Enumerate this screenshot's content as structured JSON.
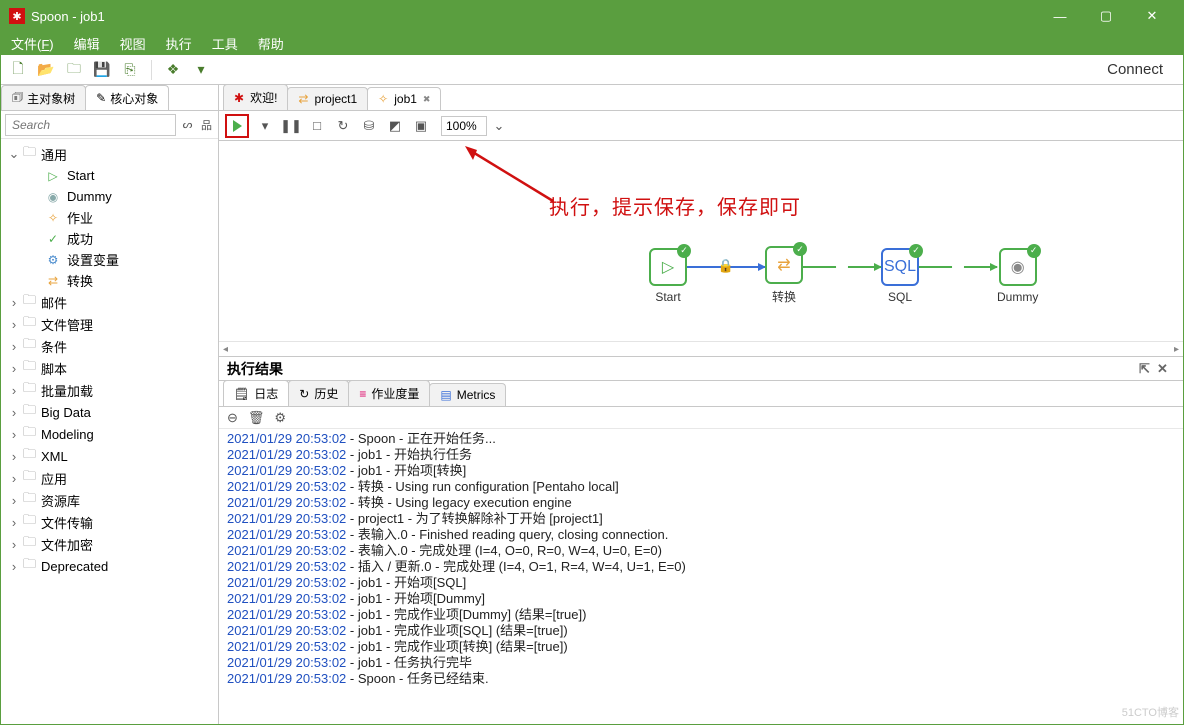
{
  "window": {
    "title": "Spoon - job1"
  },
  "menubar": [
    "文件(F)",
    "编辑",
    "视图",
    "执行",
    "工具",
    "帮助"
  ],
  "toolbar_connect": "Connect",
  "side_tabs": {
    "active": "主对象树",
    "inactive": "核心对象"
  },
  "search": {
    "placeholder": "Search"
  },
  "tree": {
    "general": {
      "label": "通用",
      "items": [
        "Start",
        "Dummy",
        "作业",
        "成功",
        "设置变量",
        "转换"
      ]
    },
    "folders": [
      "邮件",
      "文件管理",
      "条件",
      "脚本",
      "批量加载",
      "Big Data",
      "Modeling",
      "XML",
      "应用",
      "资源库",
      "文件传输",
      "文件加密",
      "Deprecated"
    ]
  },
  "doc_tabs": [
    {
      "label": "欢迎!",
      "icon": "app"
    },
    {
      "label": "project1",
      "icon": "trans"
    },
    {
      "label": "job1",
      "icon": "job",
      "closable": true,
      "active": true
    }
  ],
  "zoom": "100%",
  "annotation": "执行，提示保存，保存即可",
  "nodes": {
    "start": "Start",
    "trans": "转换",
    "sql": "SQL",
    "dummy": "Dummy"
  },
  "results_title": "执行结果",
  "results_tabs": [
    "日志",
    "历史",
    "作业度量",
    "Metrics"
  ],
  "log": [
    {
      "ts": "2021/01/29 20:53:02",
      "msg": "Spoon - 正在开始任务..."
    },
    {
      "ts": "2021/01/29 20:53:02",
      "msg": "job1 - 开始执行任务"
    },
    {
      "ts": "2021/01/29 20:53:02",
      "msg": "job1 - 开始项[转换]"
    },
    {
      "ts": "2021/01/29 20:53:02",
      "msg": "转换 - Using run configuration [Pentaho local]"
    },
    {
      "ts": "2021/01/29 20:53:02",
      "msg": "转换 - Using legacy execution engine"
    },
    {
      "ts": "2021/01/29 20:53:02",
      "msg": "project1 - 为了转换解除补丁开始  [project1]"
    },
    {
      "ts": "2021/01/29 20:53:02",
      "msg": "表输入.0 - Finished reading query, closing connection."
    },
    {
      "ts": "2021/01/29 20:53:02",
      "msg": "表输入.0 - 完成处理 (I=4, O=0, R=0, W=4, U=0, E=0)"
    },
    {
      "ts": "2021/01/29 20:53:02",
      "msg": "插入 / 更新.0 - 完成处理 (I=4, O=1, R=4, W=4, U=1, E=0)"
    },
    {
      "ts": "2021/01/29 20:53:02",
      "msg": "job1 - 开始项[SQL]"
    },
    {
      "ts": "2021/01/29 20:53:02",
      "msg": "job1 - 开始项[Dummy]"
    },
    {
      "ts": "2021/01/29 20:53:02",
      "msg": "job1 - 完成作业项[Dummy] (结果=[true])"
    },
    {
      "ts": "2021/01/29 20:53:02",
      "msg": "job1 - 完成作业项[SQL] (结果=[true])"
    },
    {
      "ts": "2021/01/29 20:53:02",
      "msg": "job1 - 完成作业项[转换] (结果=[true])"
    },
    {
      "ts": "2021/01/29 20:53:02",
      "msg": "job1 - 任务执行完毕"
    },
    {
      "ts": "2021/01/29 20:53:02",
      "msg": "Spoon - 任务已经结束."
    }
  ],
  "watermark": "51CTO博客"
}
